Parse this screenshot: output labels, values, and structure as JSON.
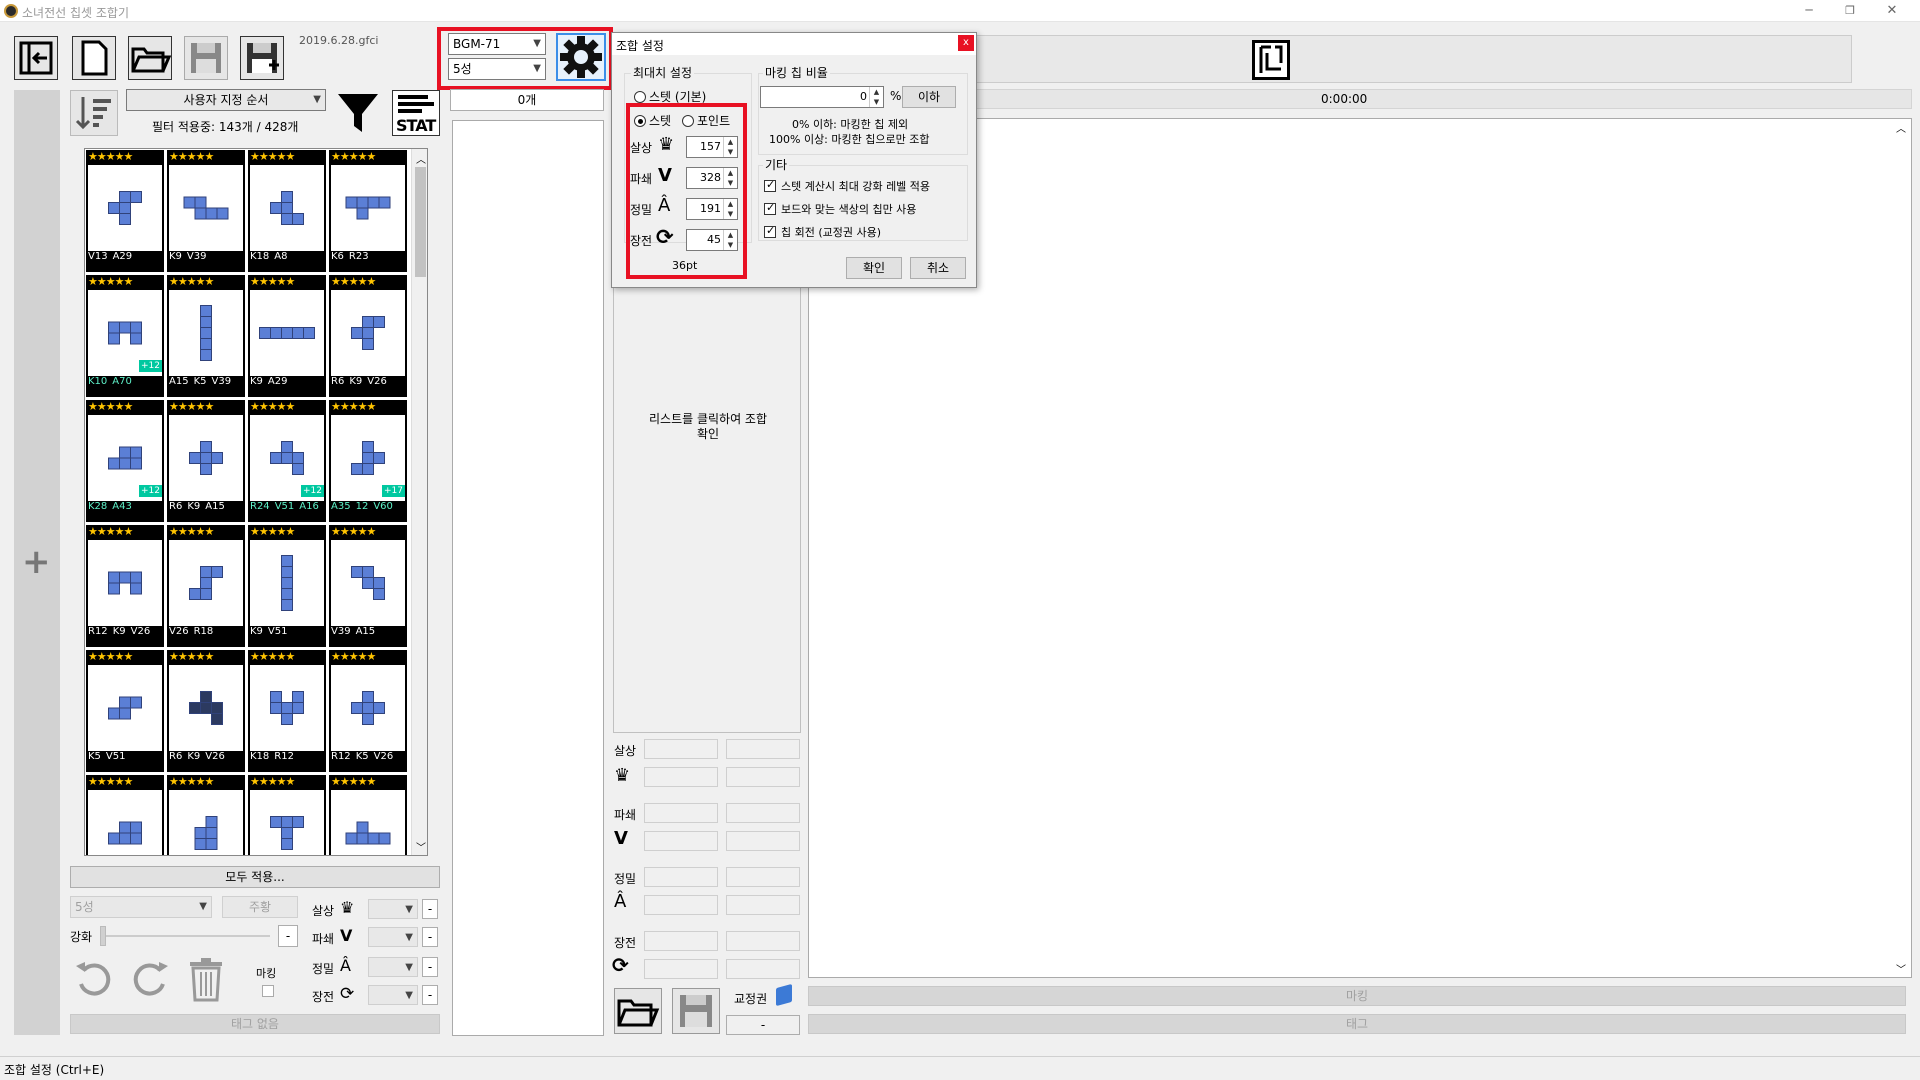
{
  "app": {
    "title": "소녀전선 칩셋 조합기",
    "version_date": "2019.6.28.gfci"
  },
  "toolbar": {
    "unit_select": "BGM-71",
    "star_select": "5성",
    "chip_count": "0개",
    "sort_select": "사용자 지정 순서",
    "filter_status": "필터 적용중: 143개 / 428개",
    "timer": "0:00:00",
    "stat_label": "STAT"
  },
  "left_panel": {
    "apply_all": "모두 적용...",
    "star_combo": "5성",
    "main_button": "주황",
    "enhance_label": "강화",
    "stat_labels": [
      "살상",
      "파쇄",
      "정밀",
      "장전"
    ],
    "mark_label": "마킹",
    "tag_none": "태그 없음",
    "minus": "-"
  },
  "chips": [
    {
      "stars": "★★★★★",
      "stats": [
        "V13",
        "A29"
      ],
      "plus": ""
    },
    {
      "stars": "★★★★★",
      "stats": [
        "K9",
        "V39"
      ],
      "plus": ""
    },
    {
      "stars": "★★★★★",
      "stats": [
        "K18",
        "A8"
      ],
      "plus": ""
    },
    {
      "stars": "★★★★★",
      "stats": [
        "K6",
        "R23"
      ],
      "plus": ""
    },
    {
      "stars": "★★★★★",
      "stats": [
        "K10",
        "A70"
      ],
      "plus": "+12"
    },
    {
      "stars": "★★★★★",
      "stats": [
        "A15",
        "K5",
        "V39"
      ],
      "plus": ""
    },
    {
      "stars": "★★★★★",
      "stats": [
        "K9",
        "A29"
      ],
      "plus": ""
    },
    {
      "stars": "★★★★★",
      "stats": [
        "R6",
        "K9",
        "V26"
      ],
      "plus": ""
    },
    {
      "stars": "★★★★★",
      "stats": [
        "K28",
        "A43"
      ],
      "plus": "+12"
    },
    {
      "stars": "★★★★★",
      "stats": [
        "R6",
        "K9",
        "A15"
      ],
      "plus": ""
    },
    {
      "stars": "★★★★★",
      "stats": [
        "R24",
        "V51",
        "A16"
      ],
      "plus": "+12"
    },
    {
      "stars": "★★★★★",
      "stats": [
        "A35",
        "12",
        "V60"
      ],
      "plus": "+17"
    },
    {
      "stars": "★★★★★",
      "stats": [
        "R12",
        "K9",
        "V26"
      ],
      "plus": ""
    },
    {
      "stars": "★★★★★",
      "stats": [
        "V26",
        "R18"
      ],
      "plus": ""
    },
    {
      "stars": "★★★★★",
      "stats": [
        "K9",
        "V51"
      ],
      "plus": ""
    },
    {
      "stars": "★★★★★",
      "stats": [
        "V39",
        "A15"
      ],
      "plus": ""
    },
    {
      "stars": "★★★★★",
      "stats": [
        "K5",
        "V51"
      ],
      "plus": ""
    },
    {
      "stars": "★★★★★",
      "stats": [
        "R6",
        "K9",
        "V26"
      ],
      "plus": ""
    },
    {
      "stars": "★★★★★",
      "stats": [
        "K18",
        "R12"
      ],
      "plus": ""
    },
    {
      "stars": "★★★★★",
      "stats": [
        "R12",
        "K5",
        "V26"
      ],
      "plus": ""
    },
    {
      "stars": "★★★★★",
      "stats": [],
      "plus": ""
    },
    {
      "stars": "★★★★★",
      "stats": [],
      "plus": ""
    },
    {
      "stars": "★★★★★",
      "stats": [],
      "plus": ""
    },
    {
      "stars": "★★★★★",
      "stats": [],
      "plus": ""
    }
  ],
  "middle": {
    "hint": "리스트를 클릭하여 조합 확인",
    "stat_labels": [
      "살상",
      "파쇄",
      "정밀",
      "장전"
    ],
    "ticket_label": "교정권",
    "ticket_value": "-"
  },
  "right": {
    "mark_bar": "마킹",
    "tag_bar": "태그"
  },
  "dialog": {
    "title": "조합 설정",
    "close": "x",
    "max_group": "최대치 설정",
    "radio_stat_basic": "스텟 (기본)",
    "radio_stat": "스텟",
    "radio_point": "포인트",
    "stats": [
      {
        "label": "살상",
        "value": "157"
      },
      {
        "label": "파쇄",
        "value": "328"
      },
      {
        "label": "정밀",
        "value": "191"
      },
      {
        "label": "장전",
        "value": "45"
      }
    ],
    "pt": "36pt",
    "mark_group": "마킹 칩 비율",
    "mark_value": "0",
    "percent": "%",
    "below_button": "이하",
    "mark_desc_1": "0% 이하: 마킹한 칩 제외",
    "mark_desc_2": "100% 이상: 마킹한 칩으로만 조합",
    "etc_group": "기타",
    "check_1": "스텟 계산시 최대 강화 레벨 적용",
    "check_2": "보드와 맞는 색상의 칩만 사용",
    "check_3": "칩 회전 (교정권 사용)",
    "ok": "확인",
    "cancel": "취소"
  },
  "statusbar": {
    "text": "조합 설정 (Ctrl+E)"
  },
  "colors": {
    "highlight": "#e81123",
    "chip_block": "#5b7fd6",
    "star": "#ffc400",
    "plus_badge": "#00c8a0"
  }
}
